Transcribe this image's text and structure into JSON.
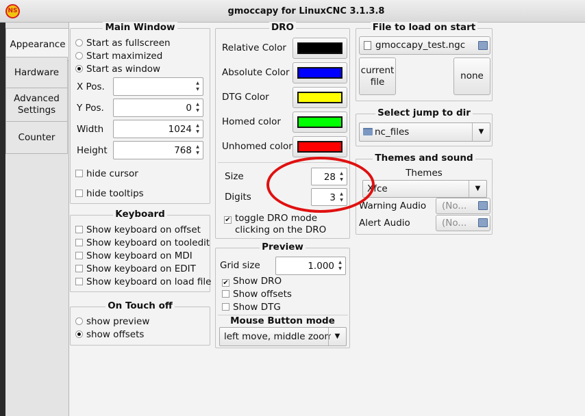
{
  "window": {
    "title": "gmoccapy for LinuxCNC  3.1.3.8"
  },
  "tabs": [
    "Appearance",
    "Hardware",
    "Advanced Settings",
    "Counter"
  ],
  "main_window": {
    "title": "Main Window",
    "options": [
      "Start as fullscreen",
      "Start maximized",
      "Start as window"
    ],
    "selected": "Start as window",
    "x_pos": {
      "label": "X Pos.",
      "value": ""
    },
    "y_pos": {
      "label": "Y Pos.",
      "value": "0"
    },
    "width": {
      "label": "Width",
      "value": "1024"
    },
    "height": {
      "label": "Height",
      "value": "768"
    },
    "hide_cursor": "hide cursor",
    "hide_tooltips": "hide tooltips"
  },
  "keyboard": {
    "title": "Keyboard",
    "options": [
      "Show keyboard on offset",
      "Show keyboard on tooledit",
      "Show keyboard on MDI",
      "Show keyboard on EDIT",
      "Show keyboard on load file"
    ]
  },
  "on_touch_off": {
    "title": "On Touch off",
    "options": [
      "show preview",
      "show offsets"
    ],
    "selected": "show offsets"
  },
  "dro": {
    "title": "DRO",
    "colors": [
      {
        "label": "Relative Color",
        "color": "#000000"
      },
      {
        "label": "Absolute Color",
        "color": "#0000ff"
      },
      {
        "label": "DTG Color",
        "color": "#ffff00"
      },
      {
        "label": "Homed color",
        "color": "#00ff00"
      },
      {
        "label": "Unhomed color",
        "color": "#ff0000"
      }
    ],
    "size": {
      "label": "Size",
      "value": "28"
    },
    "digits": {
      "label": "Digits",
      "value": "3"
    },
    "toggle": {
      "line1": "toggle DRO mode",
      "line2": "clicking on the DRO",
      "checked": true
    }
  },
  "preview": {
    "title": "Preview",
    "grid_size": {
      "label": "Grid size",
      "value": "1.000"
    },
    "show_dro": {
      "label": "Show DRO",
      "checked": true
    },
    "show_offsets": {
      "label": "Show offsets",
      "checked": false
    },
    "show_dtg": {
      "label": "Show DTG",
      "checked": false
    },
    "mouse_mode_title": "Mouse Button mode",
    "mouse_mode_value": "left move,  middle zoom"
  },
  "file_to_load": {
    "title": "File to load on start",
    "file": "gmoccapy_test.ngc",
    "current_btn": {
      "line1": "current",
      "line2": "file"
    },
    "none_btn": "none"
  },
  "jump_dir": {
    "title": "Select jump to dir",
    "value": "nc_files"
  },
  "themes_sound": {
    "title": "Themes and sound",
    "themes_label": "Themes",
    "theme_value": "Xfce",
    "warning_audio": {
      "label": "Warning Audio",
      "value": "(No..."
    },
    "alert_audio": {
      "label": "Alert Audio",
      "value": "(No..."
    }
  },
  "colors": {
    "accent_annotation": "#e01010"
  }
}
